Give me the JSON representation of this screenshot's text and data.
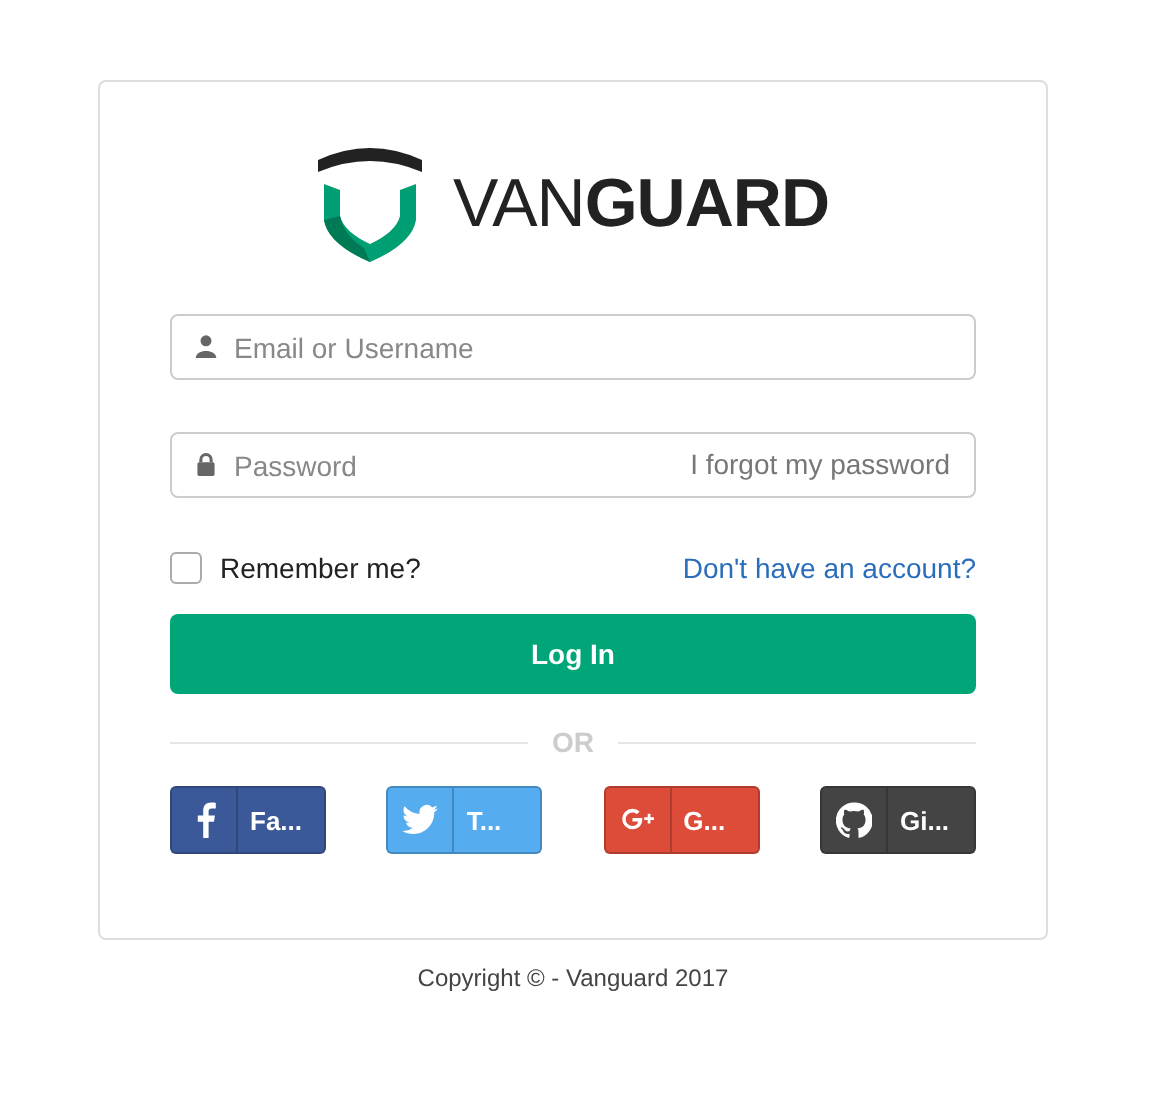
{
  "logo": {
    "text": "VAN**GUARD**"
  },
  "fields": [
    {
      "kind": "user",
      "placeholder": "Email or Username"
    },
    {
      "kind": "lock",
      "placeholder": "Password",
      "link": "I forgot my password"
    }
  ],
  "remember": {
    "label": "Remember me?",
    "checked": false
  },
  "signup_link": "Don't have an account?",
  "login_button": "Log In",
  "divider": "OR",
  "social": [
    {
      "kind": "facebook",
      "label": "Fa...",
      "color": "#3b5998"
    },
    {
      "kind": "twitter",
      "label": "T...",
      "color": "#55acee"
    },
    {
      "kind": "google",
      "label": "G...",
      "color": "#dd4b39"
    },
    {
      "kind": "github",
      "label": "Gi...",
      "color": "#444444"
    }
  ],
  "footer": "Copyright © - Vanguard 2017"
}
